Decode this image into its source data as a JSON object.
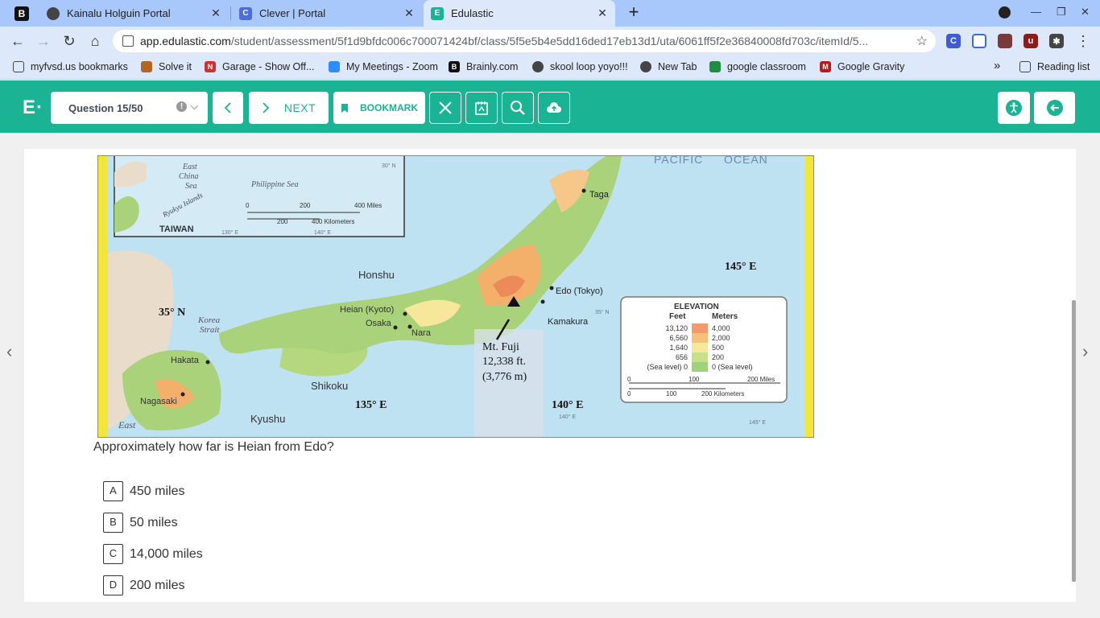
{
  "browser": {
    "tabs": [
      {
        "title": "Kainalu Holguin Portal",
        "icon": "globe-icon",
        "active": false
      },
      {
        "title": "Clever | Portal",
        "icon": "clever-c-icon",
        "active": false
      },
      {
        "title": "Edulastic",
        "icon": "edulastic-icon",
        "active": true
      }
    ],
    "url_domain": "app.edulastic.com",
    "url_path": "/student/assessment/5f1d9bfdc006c700071424bf/class/5f5e5b4e5dd16ded17eb13d1/uta/6061ff5f2e36840008fd703c/itemId/5...",
    "bookmarks": [
      {
        "label": "myfvsd.us bookmarks",
        "icon": "folder-icon"
      },
      {
        "label": "Solve it",
        "icon": "grid-icon"
      },
      {
        "label": "Garage - Show Off...",
        "icon": "garage-icon"
      },
      {
        "label": "My Meetings - Zoom",
        "icon": "zoom-icon"
      },
      {
        "label": "Brainly.com",
        "icon": "brainly-icon"
      },
      {
        "label": "skool loop yoyo!!!",
        "icon": "globe-icon"
      },
      {
        "label": "New Tab",
        "icon": "globe-icon"
      },
      {
        "label": "google classroom",
        "icon": "classroom-icon"
      },
      {
        "label": "Google Gravity",
        "icon": "gravity-icon"
      }
    ],
    "overflow": "»",
    "reading_list": "Reading list"
  },
  "header": {
    "logo": "E·",
    "question_selector": "Question 15/50",
    "next_label": "NEXT",
    "bookmark_label": "BOOKMARK"
  },
  "map": {
    "labels": {
      "pacific": "PACIFIC",
      "ocean": "OCEAN",
      "east_china": "East China Sea",
      "east": "East",
      "china": "China",
      "sea": "Sea",
      "philippine": "Philippine Sea",
      "ryukyu": "Ryukyu Islands",
      "taiwan": "TAIWAN",
      "inset_miles": "400 Miles",
      "inset_km": "400 Kilometers",
      "inset_0": "0",
      "inset_200": "200",
      "lat30": "30° N",
      "lon130": "130° E",
      "lon140s": "140° E",
      "honshu": "Honshu",
      "taga": "Taga",
      "edo": "Edo (Tokyo)",
      "kamakura": "Kamakura",
      "heian": "Heian (Kyoto)",
      "osaka": "Osaka",
      "nara": "Nara",
      "shikoku": "Shikoku",
      "kyushu": "Kyushu",
      "hakata": "Hakata",
      "nagasaki": "Nagasaki",
      "korea_strait": "Korea Strait",
      "korea": "Korea",
      "strait": "Strait",
      "fuji1": "Mt. Fuji",
      "fuji2": "12,338 ft.",
      "fuji3": "(3,776 m)",
      "lat35": "35° N",
      "lat35s": "35° N",
      "lon135": "135° E",
      "lon140": "140° E",
      "lon145": "145° E",
      "lon145s": "145° E",
      "east_sea": "East"
    },
    "legend": {
      "title": "ELEVATION",
      "feet_header": "Feet",
      "meters_header": "Meters",
      "rows": [
        {
          "feet": "13,120",
          "meters": "4,000",
          "color": "#f29a6b"
        },
        {
          "feet": "6,560",
          "meters": "2,000",
          "color": "#f7c07a"
        },
        {
          "feet": "1,640",
          "meters": "500",
          "color": "#f6e79a"
        },
        {
          "feet": "656",
          "meters": "200",
          "color": "#c9e08a"
        },
        {
          "feet": "(Sea level) 0",
          "meters": "0 (Sea level)",
          "color": "#9fd27a"
        }
      ],
      "scale_miles": [
        "0",
        "100",
        "200 Miles"
      ],
      "scale_km": [
        "0",
        "100",
        "200 Kilometers"
      ]
    }
  },
  "question": {
    "text": "Approximately how far is Heian from Edo?",
    "options": [
      {
        "key": "A",
        "text": "450 miles"
      },
      {
        "key": "B",
        "text": "50 miles"
      },
      {
        "key": "C",
        "text": "14,000 miles"
      },
      {
        "key": "D",
        "text": "200 miles"
      }
    ]
  }
}
